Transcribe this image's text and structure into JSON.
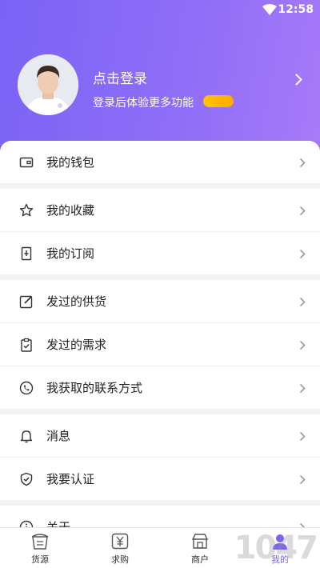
{
  "status": {
    "time": "12:58"
  },
  "profile": {
    "login_title": "点击登录",
    "login_subtitle": "登录后体验更多功能"
  },
  "menu": [
    {
      "label": "我的钱包",
      "icon": "wallet-icon"
    },
    {
      "label": "我的收藏",
      "icon": "star-icon"
    },
    {
      "label": "我的订阅",
      "icon": "subscribe-icon"
    },
    {
      "label": "发过的供货",
      "icon": "edit-icon"
    },
    {
      "label": "发过的需求",
      "icon": "clipboard-check-icon"
    },
    {
      "label": "我获取的联系方式",
      "icon": "phone-icon"
    },
    {
      "label": "消息",
      "icon": "bell-icon"
    },
    {
      "label": "我要认证",
      "icon": "shield-check-icon"
    },
    {
      "label": "关于",
      "icon": "info-icon"
    }
  ],
  "tabs": [
    {
      "label": "货源",
      "icon": "goods-icon"
    },
    {
      "label": "求购",
      "icon": "yen-icon"
    },
    {
      "label": "商户",
      "icon": "merchant-icon"
    },
    {
      "label": "我的",
      "icon": "user-icon"
    }
  ],
  "watermark": "1047",
  "colors": {
    "accent": "#7a63f6",
    "pill": "#ffb300"
  }
}
